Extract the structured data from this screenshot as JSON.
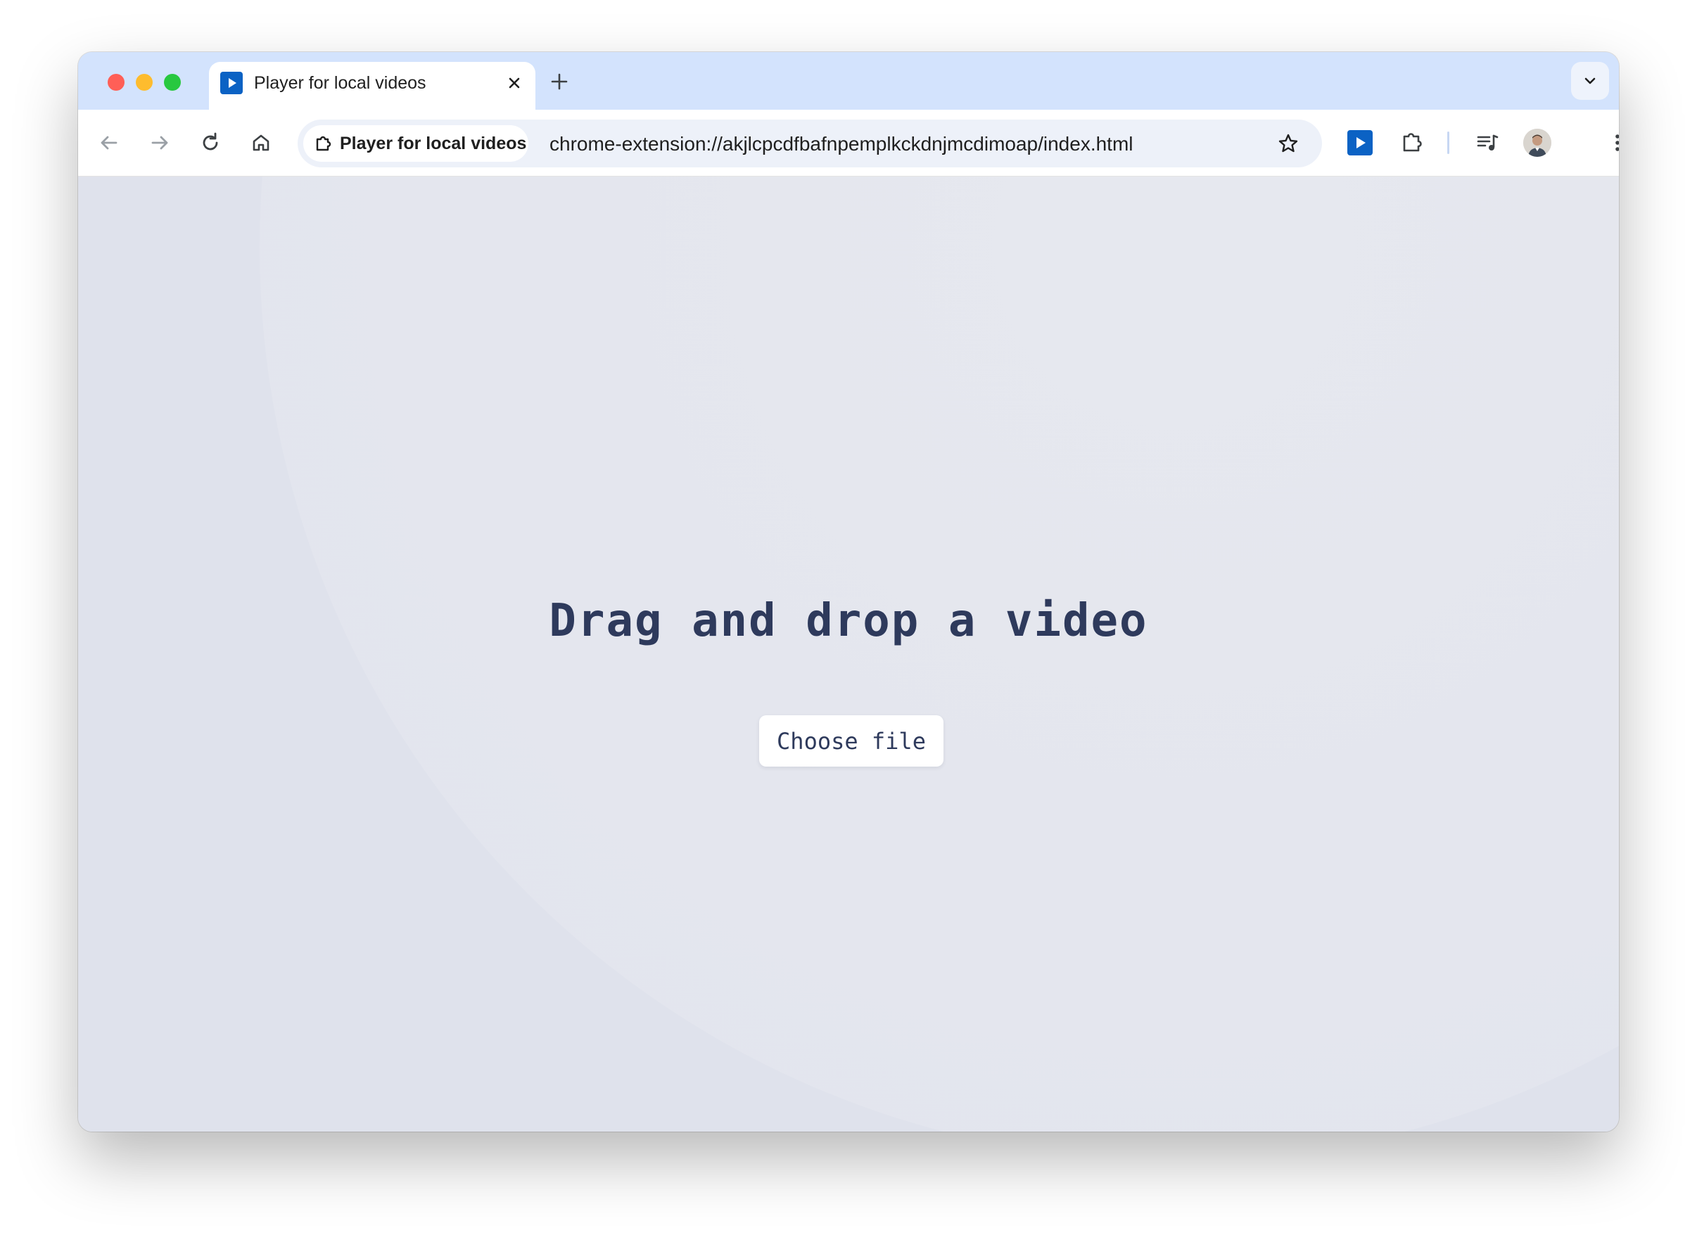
{
  "browser": {
    "tab": {
      "title": "Player for local videos"
    },
    "omnibox": {
      "chip_label": "Player for local videos",
      "url": "chrome-extension://akjlcpcdfbafnpemplkckdnjmcdimoap/index.html"
    },
    "icons": {
      "back": "arrow-left-icon",
      "forward": "arrow-right-icon",
      "reload": "reload-icon",
      "home": "home-icon",
      "bookmark": "star-icon",
      "extension_player": "play-icon",
      "extensions": "puzzle-icon",
      "media": "media-queue-icon",
      "menu": "kebab-menu-icon"
    },
    "colors": {
      "tabstrip": "#d3e3fd",
      "accent": "#0b62c4",
      "content_bg": "#dfe2ec",
      "text": "#2e3a5c"
    }
  },
  "page": {
    "headline": "Drag and drop a video",
    "choose_button": "Choose file"
  }
}
